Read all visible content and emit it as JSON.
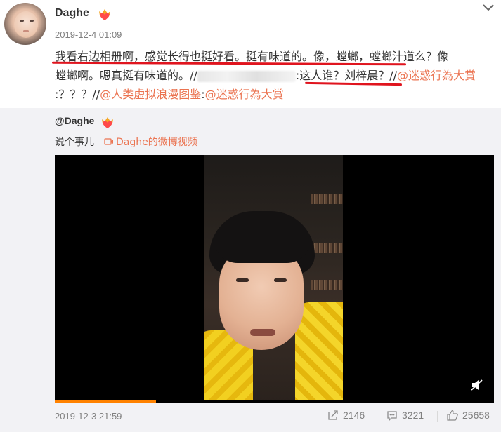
{
  "post": {
    "author": "Daghe",
    "timestamp": "2019-12-4 01:09",
    "text": {
      "line1": "我看右边相册啊，感觉长得也挺好看。挺有味道的。像，螳螂，螳螂汁道么？像",
      "line2_a": "螳螂啊。嗯真挺有味道的。//",
      "line2_b": ":这人谁？刘梓晨？//",
      "line2_mention": "@迷惑行為大賞",
      "line3_a": ":？？？//",
      "line3_mention1": "@人类虚拟浪漫图鉴",
      "line3_b": ":",
      "line3_mention2": "@迷惑行為大賞"
    }
  },
  "repost": {
    "author": "@Daghe",
    "text": "说个事儿",
    "video_link_label": "Daghe的微博视频",
    "video_progress": 0.23,
    "date": "2019-12-3 21:59",
    "shares": "2146",
    "comments": "3221",
    "likes": "25658"
  },
  "icons": {
    "vip_badge": "vip-crown-heart-icon",
    "chevron": "chevron-down-icon",
    "video_link": "video-camera-icon",
    "mute": "mute-icon",
    "share": "share-icon",
    "comment": "comment-icon",
    "like": "thumbs-up-icon"
  },
  "colors": {
    "mention": "#eb7350",
    "underline": "#e0141e",
    "progress": "#ff8200",
    "repost_bg": "#f2f2f5"
  }
}
